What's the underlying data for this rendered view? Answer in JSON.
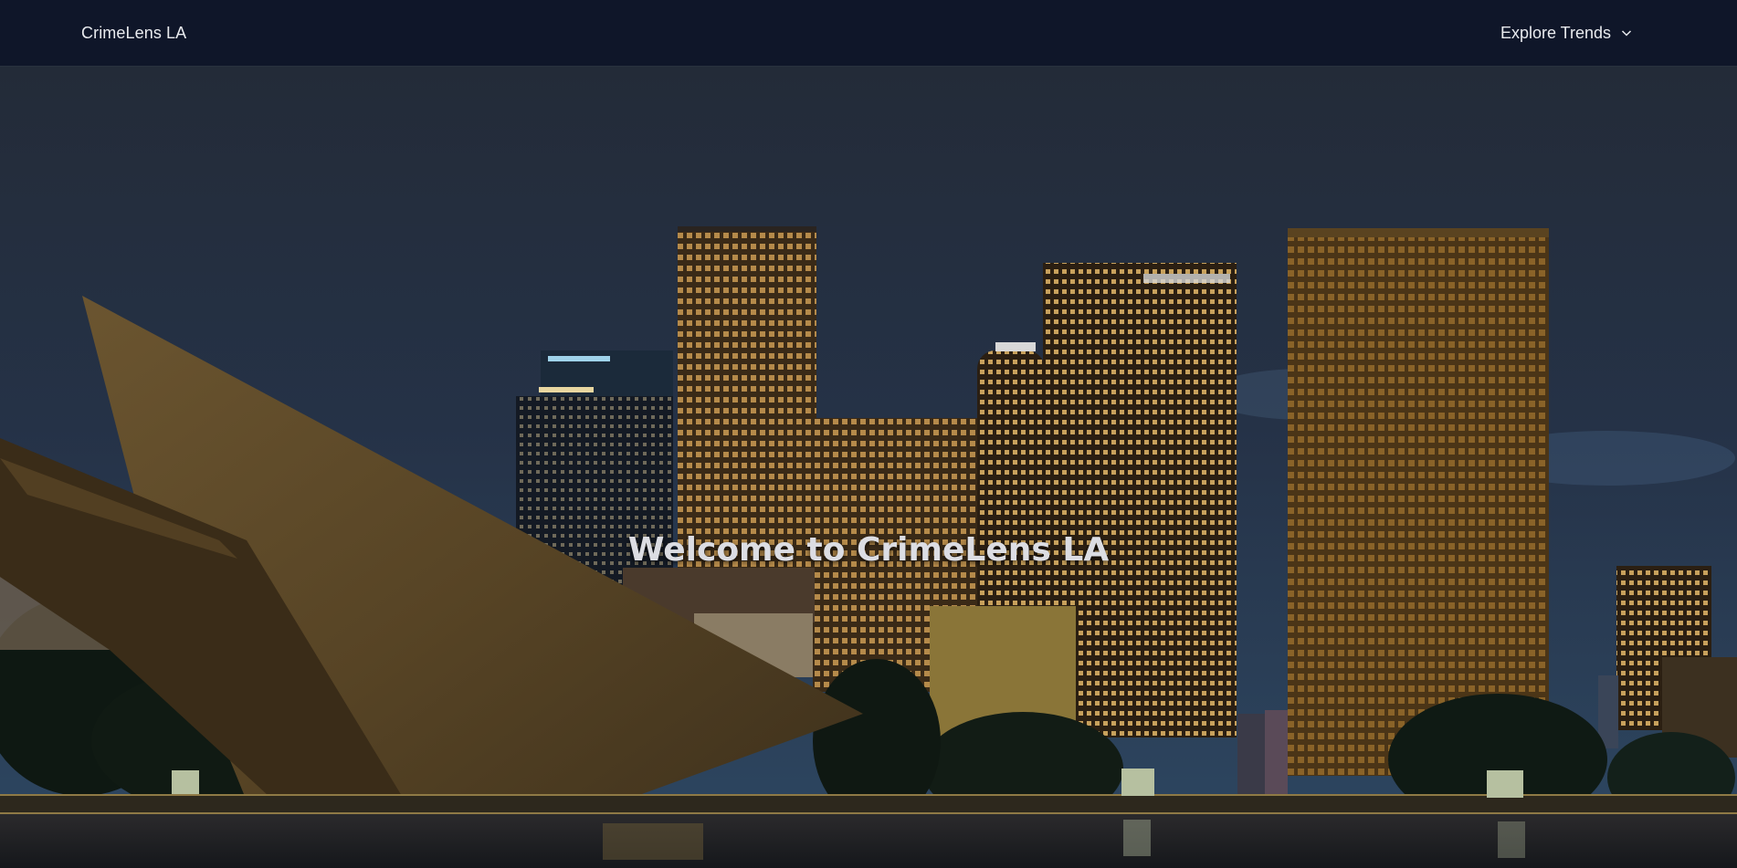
{
  "navbar": {
    "brand": "CrimeLens LA",
    "explore_label": "Explore Trends",
    "explore_icon": "chevron-down-icon"
  },
  "hero": {
    "title": "Welcome to CrimeLens LA",
    "background": "night-city-skyline-image"
  },
  "colors": {
    "nav_bg": "#0f1629",
    "nav_text": "#e8eaee",
    "hero_title": "#dcdde3"
  }
}
